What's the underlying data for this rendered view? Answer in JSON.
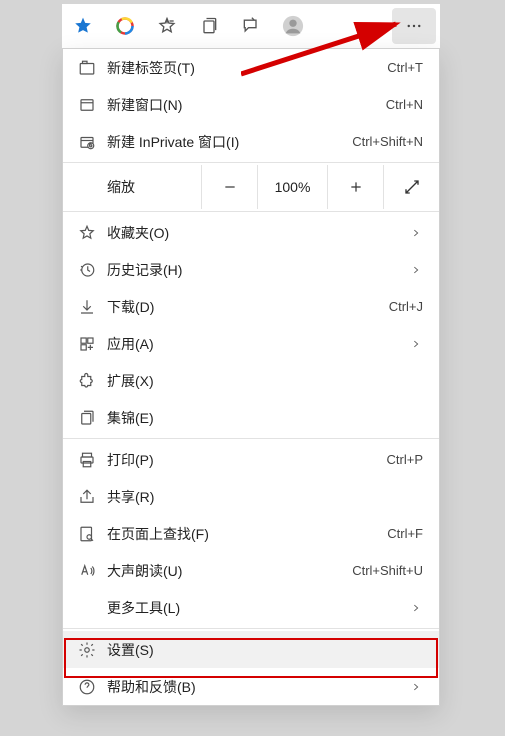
{
  "toolbar": {
    "star_icon": "star",
    "circle_icon": "opera-like",
    "fav_icon": "favorites",
    "collections_icon": "collections",
    "feedback_icon": "feedback",
    "profile_icon": "profile",
    "more_icon": "more"
  },
  "menu": {
    "new_tab": {
      "label": "新建标签页(T)",
      "hint": "Ctrl+T"
    },
    "new_window": {
      "label": "新建窗口(N)",
      "hint": "Ctrl+N"
    },
    "new_inprivate": {
      "label": "新建 InPrivate 窗口(I)",
      "hint": "Ctrl+Shift+N"
    },
    "zoom": {
      "label": "缩放",
      "value": "100%"
    },
    "favorites": {
      "label": "收藏夹(O)"
    },
    "history": {
      "label": "历史记录(H)"
    },
    "downloads": {
      "label": "下载(D)",
      "hint": "Ctrl+J"
    },
    "apps": {
      "label": "应用(A)"
    },
    "extensions": {
      "label": "扩展(X)"
    },
    "collections": {
      "label": "集锦(E)"
    },
    "print": {
      "label": "打印(P)",
      "hint": "Ctrl+P"
    },
    "share": {
      "label": "共享(R)"
    },
    "find": {
      "label": "在页面上查找(F)",
      "hint": "Ctrl+F"
    },
    "read_aloud": {
      "label": "大声朗读(U)",
      "hint": "Ctrl+Shift+U"
    },
    "more_tools": {
      "label": "更多工具(L)"
    },
    "settings": {
      "label": "设置(S)"
    },
    "help": {
      "label": "帮助和反馈(B)"
    }
  }
}
